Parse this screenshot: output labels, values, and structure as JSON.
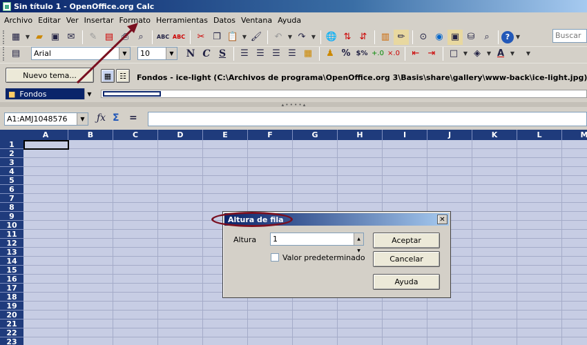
{
  "window": {
    "title": "Sin título 1 - OpenOffice.org Calc"
  },
  "menu": [
    "Archivo",
    "Editar",
    "Ver",
    "Insertar",
    "Formato",
    "Herramientas",
    "Datos",
    "Ventana",
    "Ayuda"
  ],
  "toolbar": {
    "search_placeholder": "Buscar"
  },
  "format_toolbar": {
    "font_name": "Arial",
    "font_size": "10",
    "bold": "N",
    "italic": "C",
    "underline": "S"
  },
  "gallery": {
    "new_theme_label": "Nuevo tema...",
    "path_text": "Fondos - ice-light (C:\\Archivos de programa\\OpenOffice.org 3\\Basis\\share\\gallery\\www-back\\ice-light.jpg)",
    "theme_selected": "Fondos"
  },
  "formula_bar": {
    "name_box": "A1:AMJ1048576",
    "value": ""
  },
  "sheet": {
    "columns": [
      "A",
      "B",
      "C",
      "D",
      "E",
      "F",
      "G",
      "H",
      "I",
      "J",
      "K",
      "L",
      "M"
    ],
    "rows": [
      "1",
      "2",
      "3",
      "4",
      "5",
      "6",
      "7",
      "8",
      "9",
      "10",
      "11",
      "12",
      "13",
      "14",
      "15",
      "16",
      "17",
      "18",
      "19",
      "20",
      "21",
      "22",
      "23"
    ]
  },
  "dialog": {
    "title": "Altura de fila",
    "height_label": "Altura",
    "height_value": "1",
    "default_label": "Valor predeterminado",
    "ok_label": "Aceptar",
    "cancel_label": "Cancelar",
    "help_label": "Ayuda"
  },
  "colors": {
    "accent": "#0a246a",
    "sheet_bg": "#c7cde4",
    "header_bg": "#1f3b7c",
    "annotation": "#7a1020"
  }
}
